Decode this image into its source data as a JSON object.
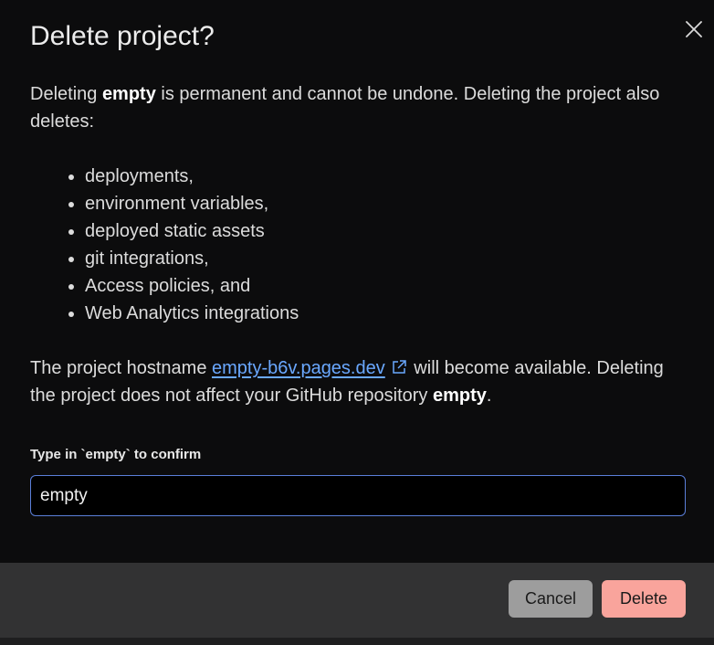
{
  "dialog": {
    "title": "Delete project?",
    "intro_prefix": "Deleting ",
    "project_name": "empty",
    "intro_suffix": " is permanent and cannot be undone. Deleting the project also deletes:",
    "deletes_items": [
      "deployments,",
      "environment variables,",
      "deployed static assets",
      "git integrations,",
      "Access policies, and",
      "Web Analytics integrations"
    ],
    "hostname_prefix": "The project hostname ",
    "hostname": "empty-b6v.pages.dev",
    "hostname_suffix": " will become available. Deleting the project does not affect your GitHub repository ",
    "repo_name": "empty",
    "repo_suffix": ".",
    "confirm_label": "Type in `empty` to confirm",
    "confirm_value": "empty",
    "cancel_label": "Cancel",
    "delete_label": "Delete"
  },
  "icons": {
    "close": "close-icon",
    "external_link": "external-link-icon"
  },
  "colors": {
    "background": "#0c0c0d",
    "link": "#6aa8ff",
    "input_border": "#5b7fd9",
    "footer": "#323233",
    "cancel_button": "#9d9d9d",
    "delete_button": "#f9a49c"
  }
}
